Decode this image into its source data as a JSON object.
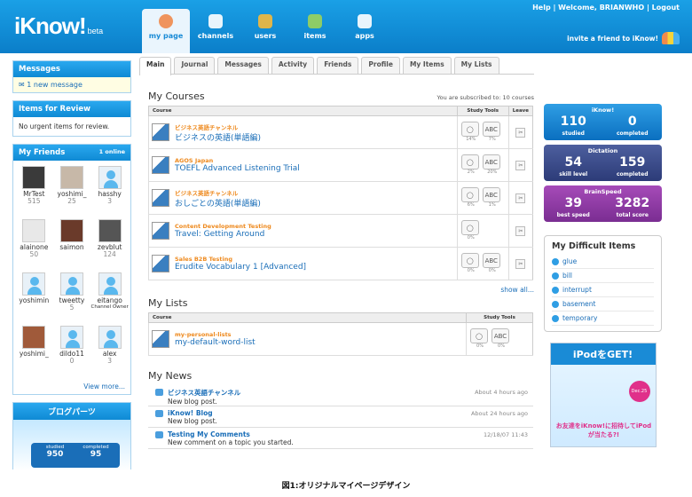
{
  "header": {
    "logo": "iKnow!",
    "logo_beta": "beta",
    "help": "Help",
    "welcome": "Welcome, BRIANWHO",
    "logout": "Logout",
    "invite": "invite a friend to iKnow!",
    "nav": [
      {
        "label": "my page",
        "icon": "home-icon"
      },
      {
        "label": "channels",
        "icon": "monitor-icon"
      },
      {
        "label": "users",
        "icon": "users-icon"
      },
      {
        "label": "items",
        "icon": "list-icon"
      },
      {
        "label": "apps",
        "icon": "app-icon"
      }
    ]
  },
  "sidebar": {
    "messages": {
      "title": "Messages",
      "text": "1 new message"
    },
    "review": {
      "title": "Items for Review",
      "text": "No urgent items for review."
    },
    "friends": {
      "title": "My Friends",
      "online": "1 online",
      "items": [
        {
          "name": "MrTest",
          "num": "515"
        },
        {
          "name": "yoshimi_",
          "num": "25"
        },
        {
          "name": "hasshy",
          "num": "3"
        },
        {
          "name": "alainone",
          "num": "50"
        },
        {
          "name": "saimon",
          "num": ""
        },
        {
          "name": "zevblut",
          "num": "124"
        },
        {
          "name": "yoshimin",
          "num": ""
        },
        {
          "name": "tweetty",
          "num": "5"
        },
        {
          "name": "eitango",
          "num": "Channel Owner"
        },
        {
          "name": "yoshimi_",
          "num": ""
        },
        {
          "name": "dildo11",
          "num": "0"
        },
        {
          "name": "alex",
          "num": "3"
        }
      ],
      "view_more": "View more..."
    },
    "blog": {
      "title": "ブログパーツ",
      "studied_label": "studied",
      "completed_label": "completed",
      "studied": "950",
      "completed": "95"
    }
  },
  "tabs": [
    "Main",
    "Journal",
    "Messages",
    "Activity",
    "Friends",
    "Profile",
    "My Items",
    "My Lists"
  ],
  "courses": {
    "title": "My Courses",
    "subscribed": "You are subscribed to: 10 courses",
    "col_course": "Course",
    "col_tools": "Study Tools",
    "col_leave": "Leave",
    "rows": [
      {
        "pub": "ビジネス英語チャンネル",
        "title": "ビジネスの英語(単語編)",
        "p1": "14%",
        "p2": "7%"
      },
      {
        "pub": "AGOS Japan",
        "title": "TOEFL Advanced Listening Trial",
        "p1": "2%",
        "p2": "20%"
      },
      {
        "pub": "ビジネス英語チャンネル",
        "title": "おしごとの英語(単語編)",
        "p1": "6%",
        "p2": "1%"
      },
      {
        "pub": "Content Development Testing",
        "title": "Travel: Getting Around",
        "p1": "0%",
        "p2": ""
      },
      {
        "pub": "Sales B2B Testing",
        "title": "Erudite Vocabulary 1 [Advanced]",
        "p1": "0%",
        "p2": "0%"
      }
    ],
    "show_all": "show all..."
  },
  "lists": {
    "title": "My Lists",
    "col_course": "Course",
    "col_tools": "Study Tools",
    "rows": [
      {
        "pub": "my-personal-lists",
        "title": "my-default-word-list",
        "p1": "0%",
        "p2": "0%"
      }
    ]
  },
  "news": {
    "title": "My News",
    "items": [
      {
        "title": "ビジネス英語チャンネル",
        "text": "New blog post.",
        "time": "About 4 hours ago"
      },
      {
        "title": "iKnow! Blog",
        "text": "New blog post.",
        "time": "About 24 hours ago"
      },
      {
        "title": "Testing My Comments",
        "text": "New comment on a topic you started.",
        "time": "12/18/07 11:43"
      }
    ]
  },
  "stats": [
    {
      "title": "iKnow!",
      "v1": "110",
      "l1": "studied",
      "v2": "0",
      "l2": "completed",
      "color": "#1a85d4"
    },
    {
      "title": "Dictation",
      "v1": "54",
      "l1": "skill level",
      "v2": "159",
      "l2": "completed",
      "color": "#3b4c8c"
    },
    {
      "title": "BrainSpeed",
      "v1": "39",
      "l1": "best speed",
      "v2": "3282",
      "l2": "total score",
      "color": "#8e38a6"
    }
  ],
  "difficult": {
    "title": "My Difficult Items",
    "items": [
      "glue",
      "bill",
      "interrupt",
      "basement",
      "temporary"
    ]
  },
  "ad": {
    "title": "iPodをGET!",
    "sub": "お友達をiKnow!に招待してiPodが当たる?!",
    "badge": "Dec.25"
  },
  "caption": "図1:オリジナルマイページデザイン"
}
